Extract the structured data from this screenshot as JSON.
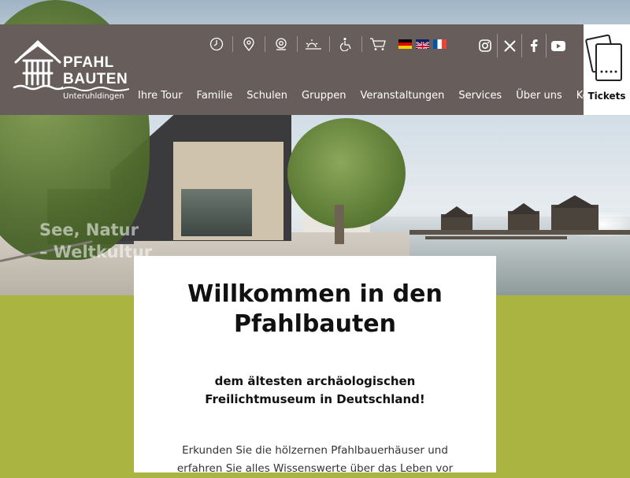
{
  "brand": {
    "line1": "PFAHL",
    "line2": "BAUTEN",
    "sub": "Unteruhldingen"
  },
  "utility_icons": [
    "clock-icon",
    "location-pin-icon",
    "webcam-icon",
    "weather-icon",
    "wheelchair-icon",
    "cart-icon"
  ],
  "languages": [
    "de",
    "en",
    "fr"
  ],
  "social": [
    "instagram-icon",
    "x-icon",
    "facebook-icon",
    "youtube-icon"
  ],
  "nav": {
    "items": [
      "Ihre Tour",
      "Familie",
      "Schulen",
      "Gruppen",
      "Veranstaltungen",
      "Services",
      "Über uns",
      "Kontakt"
    ]
  },
  "tickets": {
    "label": "Tickets"
  },
  "hero": {
    "line1": "See, Natur",
    "line2": "– Weltkultur"
  },
  "welcome": {
    "title_line1": "Willkommen in den",
    "title_line2": "Pfahlbauten",
    "subtitle_line1": "dem ältesten archäologischen",
    "subtitle_line2": "Freilichtmuseum in Deutschland!",
    "body_line1": "Erkunden Sie die hölzernen Pfahlbauerhäuser und",
    "body_line2": "erfahren Sie alles Wissenswerte über das Leben vor"
  },
  "colors": {
    "header_bg": "#675d5a",
    "accent_green": "#a9b441",
    "text_dark": "#111111"
  }
}
